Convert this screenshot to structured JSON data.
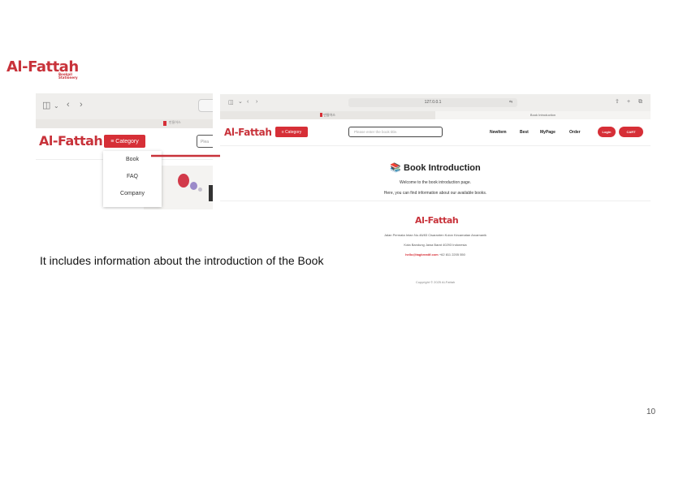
{
  "slide": {
    "logo_text": "Al-Fattah",
    "logo_sub": "Bookpil Stationery",
    "caption": "It includes information about the introduction of the Book",
    "page_number": "10"
  },
  "crop": {
    "tab_title": "만들어스",
    "logo_text": "Al-Fattah",
    "category_label": "≡ Category",
    "search_placeholder": "Plea",
    "dropdown_items": [
      "Book",
      "FAQ",
      "Company"
    ]
  },
  "browser": {
    "address": "127.0.0.1",
    "tabs": [
      "만들어스",
      "Book Introduction"
    ],
    "logo_text": "Al-Fattah",
    "category_label": "≡ Category",
    "search_placeholder": "Please enter the book title.",
    "nav": [
      "NewItem",
      "Best",
      "MyPage",
      "Order"
    ],
    "login_label": "Login",
    "cart_label": "CART",
    "page_title": "📚 Book Introduction",
    "welcome_text": "Welcome to the book introduction page.",
    "info_text": "Here, you can find information about our available books.",
    "footer": {
      "logo_text": "Al-Fattah",
      "address": "Jalan Permata Intan No.46/83 Cisaranten Kulon Kecamatan Arcamanik",
      "city": "Kota Bandung Jawa Barat 40293 Indonesia",
      "email": "hello@tagkreatif.com",
      "phone": "+62 811 2205 550",
      "copyright": "Copyright © 2025 Al-Fattah"
    }
  },
  "colors": {
    "brand_red": "#d62f37",
    "arrow": "#c8323a"
  },
  "icons": [
    "sidebar-icon",
    "chevron-down-icon",
    "back-icon",
    "forward-icon",
    "share-icon",
    "new-tab-icon",
    "tabs-icon",
    "translate-icon",
    "bag-icon"
  ]
}
